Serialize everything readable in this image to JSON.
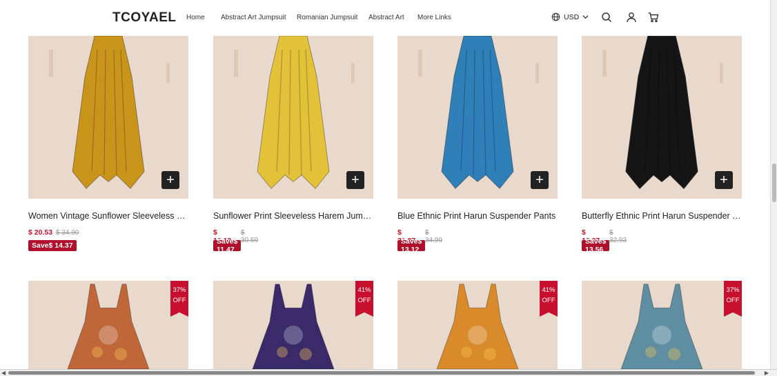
{
  "header": {
    "logo": "TCOYAEL",
    "nav": [
      "Home",
      "Abstract Art Jumpsuit",
      "Romanian Jumpsuit",
      "Abstract Art",
      "More Links"
    ],
    "currency": "USD",
    "icons": [
      "globe-icon",
      "chevron-down-icon",
      "search-icon",
      "account-icon",
      "cart-icon"
    ]
  },
  "row1": [
    {
      "title": "Women Vintage Sunflower Sleeveless Harem Jumpsuit",
      "price": "$ 20.53",
      "old": "$ 34.90",
      "save": "Save$ 14.37",
      "color": "#c8951a"
    },
    {
      "title": "Sunflower Print Sleeveless Harem Jumpsuit",
      "price": "$ 19.12",
      "old": "$ 30.59",
      "save": "Save$ 11.47",
      "color": "#e3c23a"
    },
    {
      "title": "Blue Ethnic Print Harun Suspender Pants",
      "price": "$ 21.87",
      "old": "$ 34.99",
      "save": "Save$ 13.12",
      "color": "#2f7fb8"
    },
    {
      "title": "Butterfly Ethnic Print Harun Suspender Pants",
      "price": "$ 19.37",
      "old": "$ 32.93",
      "save": "Save$ 13.56",
      "color": "#151515"
    }
  ],
  "row2": [
    {
      "badge1": "37%",
      "badge2": "OFF",
      "color": "#c0673a"
    },
    {
      "badge1": "41%",
      "badge2": "OFF",
      "color": "#3a2a6a"
    },
    {
      "badge1": "41%",
      "badge2": "OFF",
      "color": "#d98a2a"
    },
    {
      "badge1": "37%",
      "badge2": "OFF",
      "color": "#5f8ea3"
    }
  ],
  "plus_label": "+"
}
